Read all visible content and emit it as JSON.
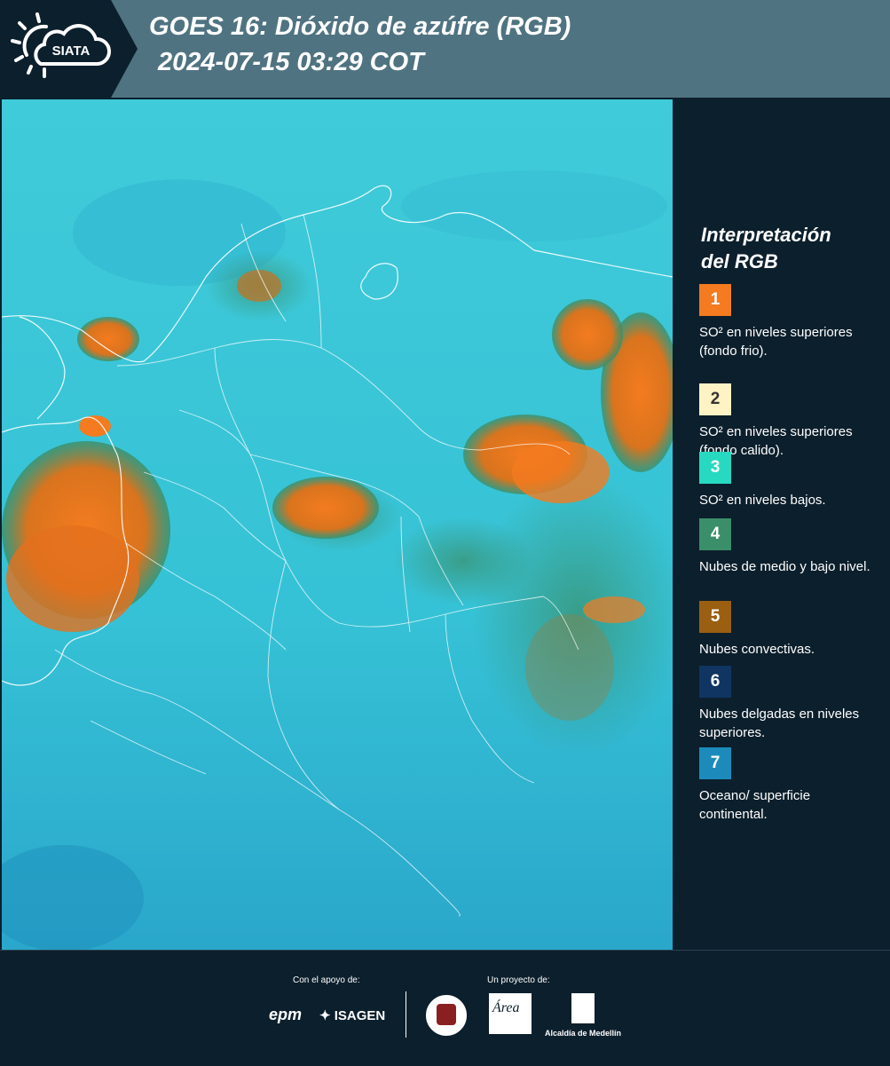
{
  "header": {
    "logo_text": "SIATA",
    "title_line1": "GOES 16: Dióxido de azúfre (RGB)",
    "title_line2": "2024-07-15 03:29 COT"
  },
  "legend": {
    "title_line1": "Interpretación",
    "title_line2": "del RGB",
    "items": [
      {
        "number": "1",
        "color": "#f47b1f",
        "text": "SO² en niveles superiores (fondo frio)."
      },
      {
        "number": "2",
        "color": "#fdf3c5",
        "text": "SO² en niveles superiores (fondo calido)."
      },
      {
        "number": "3",
        "color": "#27d9c0",
        "text": "SO² en niveles bajos."
      },
      {
        "number": "4",
        "color": "#3a8e69",
        "text": "Nubes de medio y bajo nivel."
      },
      {
        "number": "5",
        "color": "#9b5f12",
        "text": "Nubes convectivas."
      },
      {
        "number": "6",
        "color": "#103563",
        "text": "Nubes delgadas en niveles superiores."
      },
      {
        "number": "7",
        "color": "#1c8bbb",
        "text": "Oceano/ superficie continental."
      }
    ]
  },
  "footer": {
    "support_label": "Con el apoyo de:",
    "project_label": "Un proyecto de:",
    "sponsors": [
      "epm",
      "ISAGEN"
    ],
    "partners": [
      "Área Metropolitana Valle de Aburrá",
      "Alcaldía de Medellín"
    ],
    "partner_caption": "Alcaldía de Medellín"
  },
  "colors": {
    "header_bg": "#4f7381",
    "sidebar_bg": "#0c1f2c",
    "surface": "#38c5d7",
    "cloud_orange": "#f47b1f",
    "cloud_green": "#3a8e69"
  }
}
